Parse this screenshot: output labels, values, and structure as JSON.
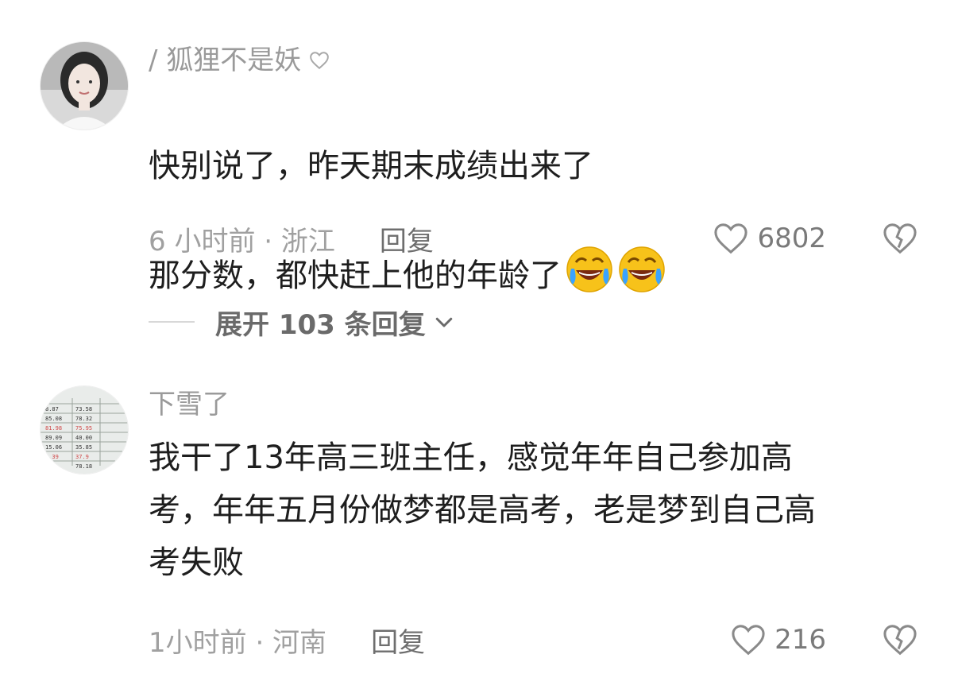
{
  "comments": [
    {
      "username": "/ 狐狸不是妖",
      "text_line1": "快别说了，昨天期末成绩出来了",
      "text_line2": "那分数，都快赶上他的年龄了",
      "emojis": [
        "laugh-cry-emoji",
        "laugh-cry-emoji"
      ],
      "time_location": "6 小时前 · 浙江",
      "reply_label": "回复",
      "likes": "6802"
    },
    {
      "username": "下雪了",
      "text": "我干了13年高三班主任，感觉年年自己参加高\n考，年年五月份做梦都是高考，老是梦到自己高\n考失败",
      "time_location": "1小时前 · 河南",
      "reply_label": "回复",
      "likes": "216"
    }
  ],
  "expand_replies": "展开 103 条回复",
  "colors": {
    "meta": "#a0a0a0",
    "text": "#1e1e1e",
    "emoji_yellow": "#f7c21a"
  }
}
